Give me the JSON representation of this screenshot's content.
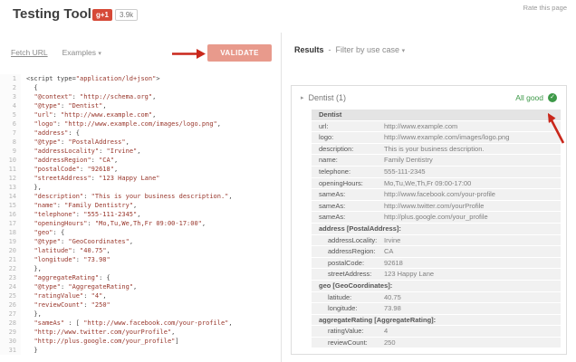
{
  "icons": {
    "caret_down": "▾",
    "triangle_right": "▸",
    "check": "✓"
  },
  "colors": {
    "annotation_red": "#c9271b",
    "validate_bg": "#e89a8c",
    "status_green": "#3d9948",
    "plusone_red": "#d64937"
  },
  "header": {
    "title": "Testing Tool",
    "plusone_label": "g+1",
    "plusone_count": "3.9k",
    "rate_link": "Rate this page"
  },
  "toolbar": {
    "fetch_url": "Fetch URL",
    "examples": "Examples",
    "validate": "VALIDATE"
  },
  "editor": {
    "lines": [
      "<script type=\"application/ld+json\">",
      "  {",
      "  \"@context\": \"http://schema.org\",",
      "  \"@type\": \"Dentist\",",
      "  \"url\": \"http://www.example.com\",",
      "  \"logo\": \"http://www.example.com/images/logo.png\",",
      "  \"address\": {",
      "  \"@type\": \"PostalAddress\",",
      "  \"addressLocality\": \"Irvine\",",
      "  \"addressRegion\": \"CA\",",
      "  \"postalCode\": \"92618\",",
      "  \"streetAddress\": \"123 Happy Lane\"",
      "  },",
      "  \"description\": \"This is your business description.\",",
      "  \"name\": \"Family Dentistry\",",
      "  \"telephone\": \"555-111-2345\",",
      "  \"openingHours\": \"Mo,Tu,We,Th,Fr 09:00-17:00\",",
      "  \"geo\": {",
      "  \"@type\": \"GeoCoordinates\",",
      "  \"latitude\": \"40.75\",",
      "  \"longitude\": \"73.98\"",
      "  },",
      "  \"aggregateRating\": {",
      "  \"@type\": \"AggregateRating\",",
      "  \"ratingValue\": \"4\",",
      "  \"reviewCount\": \"250\"",
      "  },",
      "  \"sameAs\" : [ \"http://www.facebook.com/your-profile\",",
      "  \"http://www.twitter.com/yourProfile\",",
      "  \"http://plus.google.com/your_profile\"]",
      "  }"
    ]
  },
  "results": {
    "label": "Results",
    "separator": "-",
    "filter_label": "Filter by use case",
    "group_title": "Dentist (1)",
    "status": "All good",
    "table": {
      "header": "Dentist",
      "rows": [
        {
          "key": "url:",
          "value": "http://www.example.com"
        },
        {
          "key": "logo:",
          "value": "http://www.example.com/images/logo.png"
        },
        {
          "key": "description:",
          "value": "This is your business description."
        },
        {
          "key": "name:",
          "value": "Family Dentistry"
        },
        {
          "key": "telephone:",
          "value": "555-111-2345"
        },
        {
          "key": "openingHours:",
          "value": "Mo,Tu,We,Th,Fr 09:00-17:00"
        },
        {
          "key": "sameAs:",
          "value": "http://www.facebook.com/your-profile"
        },
        {
          "key": "sameAs:",
          "value": "http://www.twitter.com/yourProfile"
        },
        {
          "key": "sameAs:",
          "value": "http://plus.google.com/your_profile"
        },
        {
          "key": "address [PostalAddress]:",
          "section": true
        },
        {
          "key": "addressLocality:",
          "value": "Irvine",
          "indent": true
        },
        {
          "key": "addressRegion:",
          "value": "CA",
          "indent": true
        },
        {
          "key": "postalCode:",
          "value": "92618",
          "indent": true
        },
        {
          "key": "streetAddress:",
          "value": "123 Happy Lane",
          "indent": true
        },
        {
          "key": "geo [GeoCoordinates]:",
          "section": true
        },
        {
          "key": "latitude:",
          "value": "40.75",
          "indent": true
        },
        {
          "key": "longitude:",
          "value": "73.98",
          "indent": true
        },
        {
          "key": "aggregateRating [AggregateRating]:",
          "section": true
        },
        {
          "key": "ratingValue:",
          "value": "4",
          "indent": true
        },
        {
          "key": "reviewCount:",
          "value": "250",
          "indent": true
        }
      ]
    }
  }
}
